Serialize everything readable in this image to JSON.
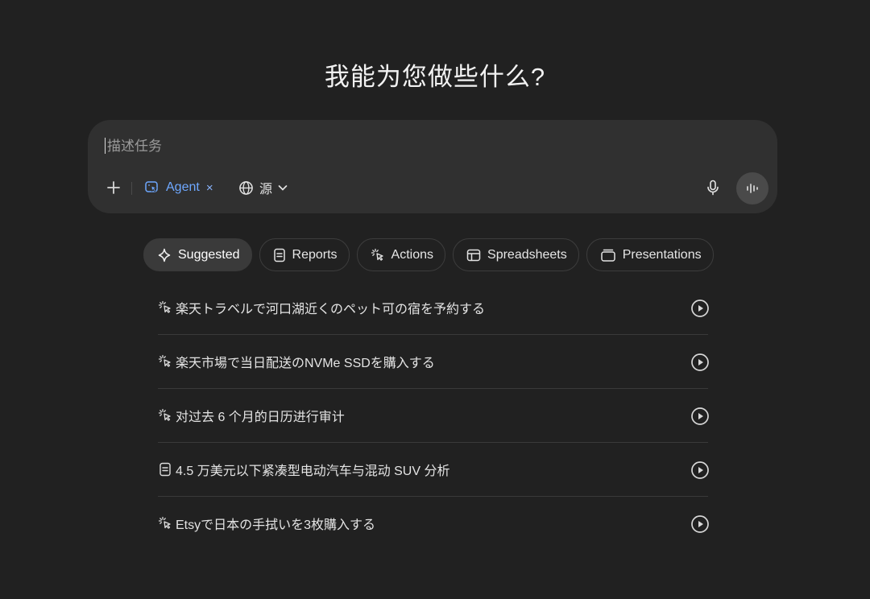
{
  "heading": "我能为您做些什么?",
  "composer": {
    "placeholder": "描述任务",
    "agent_label": "Agent",
    "agent_close": "×",
    "source_label": "源",
    "icons": {
      "add": "plus-icon",
      "agent": "agent-cursor-icon",
      "source": "globe-icon",
      "source_chevron": "chevron-down-icon",
      "mic": "microphone-icon",
      "voice": "voice-waveform-icon"
    },
    "colors": {
      "agent_accent": "#6ea8ff",
      "surface": "#303030"
    }
  },
  "tabs": [
    {
      "label": "Suggested",
      "icon": "sparkle-icon",
      "active": true
    },
    {
      "label": "Reports",
      "icon": "document-icon",
      "active": false
    },
    {
      "label": "Actions",
      "icon": "cursor-click-icon",
      "active": false
    },
    {
      "label": "Spreadsheets",
      "icon": "table-icon",
      "active": false
    },
    {
      "label": "Presentations",
      "icon": "slides-icon",
      "active": false
    }
  ],
  "suggestions": [
    {
      "text": "楽天トラベルで河口湖近くのペット可の宿を予約する",
      "icon": "cursor-click-icon"
    },
    {
      "text": "楽天市場で当日配送のNVMe SSDを購入する",
      "icon": "cursor-click-icon"
    },
    {
      "text": "对过去 6 个月的日历进行审计",
      "icon": "cursor-click-icon"
    },
    {
      "text": "4.5 万美元以下紧凑型电动汽车与混动 SUV 分析",
      "icon": "document-icon"
    },
    {
      "text": "Etsyで日本の手拭いを3枚購入する",
      "icon": "cursor-click-icon"
    }
  ],
  "colors": {
    "background": "#212121",
    "divider": "#3a3a3a",
    "active_tab": "#3a3a3a"
  }
}
